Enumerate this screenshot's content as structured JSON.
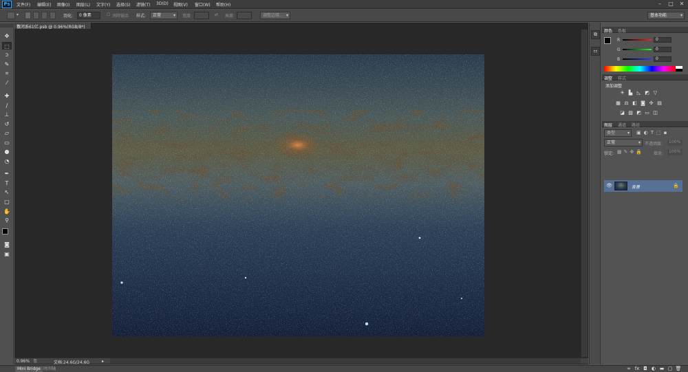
{
  "app": {
    "logo": "Ps"
  },
  "menubar": {
    "items": [
      "文件(F)",
      "编辑(E)",
      "图像(I)",
      "图层(L)",
      "文字(Y)",
      "选择(S)",
      "滤镜(T)",
      "3D(D)",
      "视图(V)",
      "窗口(W)",
      "帮助(H)"
    ],
    "window_controls": [
      "minimize-icon",
      "maximize-icon",
      "close-icon"
    ]
  },
  "options_bar": {
    "feather_label": "羽化:",
    "feather_value": "0 像素",
    "antialias_label": "消除锯齿",
    "style_label": "样式:",
    "style_value": "正常",
    "width_label": "宽度:",
    "height_label": "高度:",
    "refine_edge_label": "调整边缘...",
    "workspace_value": "基本功能"
  },
  "document": {
    "tab_title": "银河系61亿.psb @ 0.96%(RGB/8*)",
    "zoom": "0.96%",
    "doc_size": "文档:24.6G/24.6G"
  },
  "bottom_tabs": {
    "mini_bridge": "Mini Bridge",
    "timeline": "时间轴"
  },
  "color_panel": {
    "tabs": [
      "颜色",
      "色板"
    ],
    "channels": [
      {
        "label": "R",
        "value": "0",
        "color": "#e02020"
      },
      {
        "label": "G",
        "value": "0",
        "color": "#20c020"
      },
      {
        "label": "B",
        "value": "0",
        "color": "#2040e0"
      }
    ]
  },
  "adjustments_panel": {
    "tabs": [
      "调整",
      "样式"
    ],
    "title": "添加调整",
    "icons": [
      [
        "brightness-icon",
        "levels-icon",
        "curves-icon",
        "exposure-icon",
        "vibrance-icon"
      ],
      [
        "hue-saturation-icon",
        "color-balance-icon",
        "black-white-icon",
        "photo-filter-icon",
        "channel-mixer-icon",
        "color-lookup-icon"
      ],
      [
        "invert-icon",
        "posterize-icon",
        "threshold-icon",
        "gradient-map-icon",
        "selective-color-icon"
      ]
    ]
  },
  "layers_panel": {
    "tabs": [
      "图层",
      "通道",
      "路径"
    ],
    "filter_label": "类型",
    "blend_mode": "正常",
    "opacity_label": "不透明度:",
    "opacity_value": "100%",
    "lock_label": "锁定:",
    "fill_label": "填充:",
    "fill_value": "100%",
    "layers": [
      {
        "name": "背景",
        "visible": true,
        "locked": true
      }
    ]
  },
  "tools": [
    "move-tool-icon",
    "marquee-tool-icon",
    "lasso-tool-icon",
    "quick-select-tool-icon",
    "crop-tool-icon",
    "eyedropper-tool-icon",
    "healing-brush-tool-icon",
    "brush-tool-icon",
    "clone-stamp-tool-icon",
    "history-brush-tool-icon",
    "eraser-tool-icon",
    "gradient-tool-icon",
    "blur-tool-icon",
    "dodge-tool-icon",
    "pen-tool-icon",
    "type-tool-icon",
    "path-select-tool-icon",
    "rectangle-tool-icon",
    "hand-tool-icon",
    "zoom-tool-icon"
  ]
}
